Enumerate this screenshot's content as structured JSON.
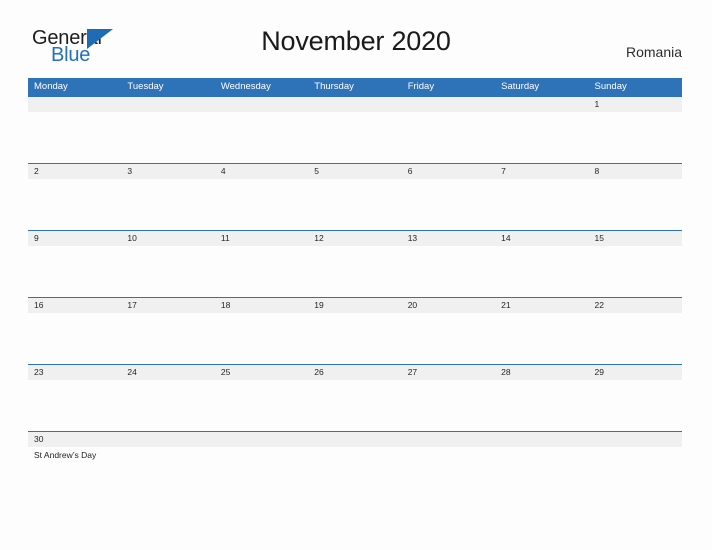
{
  "brand": {
    "name_part1": "General",
    "name_part2": "Blue",
    "flag_color": "#2272bb",
    "text_color": "#1d1d1d"
  },
  "header": {
    "title": "November 2020",
    "country": "Romania"
  },
  "theme": {
    "header_blue": "#2e72b8",
    "row_rule_blue": "#2e72b8",
    "date_strip_gray": "#f0f0f0",
    "page_background": "#fdfdfd",
    "weekday_text": "#ffffff"
  },
  "calendar": {
    "month": "November",
    "year": "2020",
    "weekday_headers": [
      "Monday",
      "Tuesday",
      "Wednesday",
      "Thursday",
      "Friday",
      "Saturday",
      "Sunday"
    ],
    "weeks": [
      {
        "days": [
          {
            "date": "",
            "events": []
          },
          {
            "date": "",
            "events": []
          },
          {
            "date": "",
            "events": []
          },
          {
            "date": "",
            "events": []
          },
          {
            "date": "",
            "events": []
          },
          {
            "date": "",
            "events": []
          },
          {
            "date": "1",
            "events": []
          }
        ]
      },
      {
        "days": [
          {
            "date": "2",
            "events": []
          },
          {
            "date": "3",
            "events": []
          },
          {
            "date": "4",
            "events": []
          },
          {
            "date": "5",
            "events": []
          },
          {
            "date": "6",
            "events": []
          },
          {
            "date": "7",
            "events": []
          },
          {
            "date": "8",
            "events": []
          }
        ]
      },
      {
        "days": [
          {
            "date": "9",
            "events": []
          },
          {
            "date": "10",
            "events": []
          },
          {
            "date": "11",
            "events": []
          },
          {
            "date": "12",
            "events": []
          },
          {
            "date": "13",
            "events": []
          },
          {
            "date": "14",
            "events": []
          },
          {
            "date": "15",
            "events": []
          }
        ]
      },
      {
        "days": [
          {
            "date": "16",
            "events": []
          },
          {
            "date": "17",
            "events": []
          },
          {
            "date": "18",
            "events": []
          },
          {
            "date": "19",
            "events": []
          },
          {
            "date": "20",
            "events": []
          },
          {
            "date": "21",
            "events": []
          },
          {
            "date": "22",
            "events": []
          }
        ]
      },
      {
        "days": [
          {
            "date": "23",
            "events": []
          },
          {
            "date": "24",
            "events": []
          },
          {
            "date": "25",
            "events": []
          },
          {
            "date": "26",
            "events": []
          },
          {
            "date": "27",
            "events": []
          },
          {
            "date": "28",
            "events": []
          },
          {
            "date": "29",
            "events": []
          }
        ]
      },
      {
        "days": [
          {
            "date": "30",
            "events": [
              "St Andrew’s Day"
            ]
          },
          {
            "date": "",
            "events": []
          },
          {
            "date": "",
            "events": []
          },
          {
            "date": "",
            "events": []
          },
          {
            "date": "",
            "events": []
          },
          {
            "date": "",
            "events": []
          },
          {
            "date": "",
            "events": []
          }
        ]
      }
    ]
  }
}
